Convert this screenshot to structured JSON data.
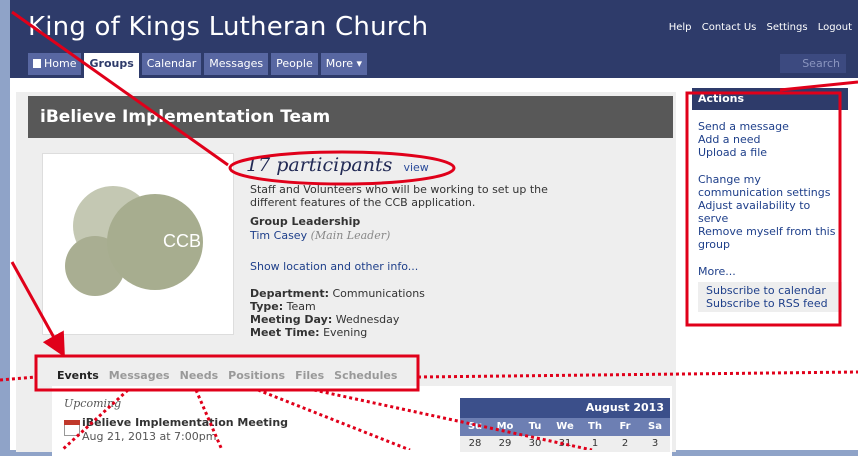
{
  "church_title": "King of Kings Lutheran Church",
  "top_links": [
    "Help",
    "Contact Us",
    "Settings",
    "Logout"
  ],
  "nav_tabs": [
    "Home",
    "Groups",
    "Calendar",
    "Messages",
    "People",
    "More ▾"
  ],
  "search_placeholder": "Search",
  "group_name": "iBelieve Implementation Team",
  "logo_text": "CCB",
  "participants": {
    "count": "17 participants",
    "view": "view"
  },
  "description": "Staff and Volunteers who will be working to set up the different features of the CCB application.",
  "leadership": {
    "label": "Group Leadership",
    "leader": "Tim Casey",
    "role": "(Main Leader)"
  },
  "location_link": "Show location and other info...",
  "info": {
    "department_label": "Department:",
    "department": "Communications",
    "type_label": "Type:",
    "type": "Team",
    "meeting_day_label": "Meeting Day:",
    "meeting_day": "Wednesday",
    "meet_time_label": "Meet Time:",
    "meet_time": "Evening"
  },
  "content_tabs": [
    "Events",
    "Messages",
    "Needs",
    "Positions",
    "Files",
    "Schedules"
  ],
  "events": {
    "upcoming_label": "Upcoming",
    "event_title": "iBelieve Implementation Meeting",
    "event_date": "Aug 21, 2013 at 7:00pm"
  },
  "calendar": {
    "month": "August 2013",
    "days": [
      "Su",
      "Mo",
      "Tu",
      "We",
      "Th",
      "Fr",
      "Sa"
    ],
    "first_row": [
      "28",
      "29",
      "30",
      "31",
      "1",
      "2",
      "3"
    ]
  },
  "actions": {
    "header": "Actions",
    "group1": [
      "Send a message",
      "Add a need",
      "Upload a file"
    ],
    "group2": [
      "Change my communication settings",
      "Adjust availability to serve",
      "Remove myself from this group"
    ],
    "more": "More...",
    "subscribe": [
      "Subscribe to calendar",
      "Subscribe to RSS feed"
    ]
  },
  "colors": {
    "brand_navy": "#2e3b6a",
    "nav_tab": "#5867a2",
    "header_gray": "#585858",
    "annotation_red": "#e0001a",
    "logo_green": "#a7ad8f"
  }
}
